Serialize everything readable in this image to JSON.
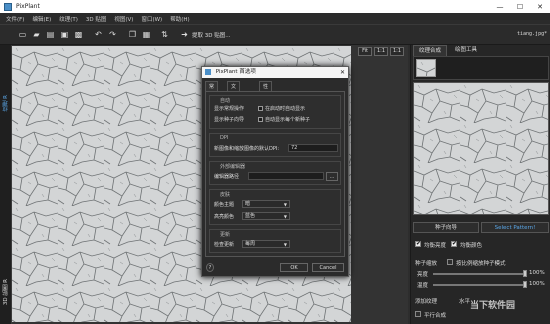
{
  "window": {
    "title": "PixPlant",
    "minimize": "—",
    "maximize": "☐",
    "close": "✕"
  },
  "menu": [
    "文件(F)",
    "编辑(E)",
    "纹理(T)",
    "3D 贴图",
    "视图(V)",
    "窗口(W)",
    "帮助(H)"
  ],
  "toolbar": {
    "extract_label": "提取 3D 贴图...",
    "filename": "tiang.jpg*"
  },
  "left_strip": {
    "top_label": "纹理 R",
    "bottom_label": "3D 贴图 R"
  },
  "view_buttons": [
    "Fit",
    "1:1",
    "1:1"
  ],
  "right_panel": {
    "tabs": [
      "纹理合成",
      "绘图工具"
    ],
    "seed_button": "种子向导",
    "select_pattern_button": "Select Pattern!",
    "checks": [
      {
        "label": "均衡亮度",
        "checked": true
      },
      {
        "label": "均衡颜色",
        "checked": true
      }
    ],
    "seed_zoom_label": "种子缩放",
    "seed_zoom_mode": "按比例缩放种子模式",
    "sliders": [
      {
        "label": "亮度",
        "value": "100%",
        "level": 1.0
      },
      {
        "label": "温度",
        "value": "100%",
        "level": 1.0
      }
    ],
    "add_texture_label": "添加纹理",
    "add_texture_value": "水平",
    "tile_check_label": "平行合成"
  },
  "dialog": {
    "title": "PixPlant 首选项",
    "tabs": [
      "常规",
      "文件处理",
      "性能"
    ],
    "auto_section": {
      "title": "自动",
      "rows": [
        {
          "label": "显示常规操作",
          "option": "在启动时自动显示"
        },
        {
          "label": "显示种子向导",
          "option": "自动显示每个新种子"
        }
      ]
    },
    "dpi_section": {
      "title": "DPI",
      "label": "新图像和缩放图像的默认DPI:",
      "value": "72"
    },
    "editor_section": {
      "title": "外部编辑器",
      "label": "编辑器路径",
      "value": ""
    },
    "skin_section": {
      "title": "皮肤",
      "rows": [
        {
          "label": "颜色主题",
          "value": "暗"
        },
        {
          "label": "高亮颜色",
          "value": "蓝色"
        }
      ]
    },
    "update_section": {
      "title": "更新",
      "label": "检查更新",
      "value": "每周"
    },
    "help_button": "?",
    "ok_button": "OK",
    "cancel_button": "Cancel"
  },
  "watermark": "当下软件园"
}
